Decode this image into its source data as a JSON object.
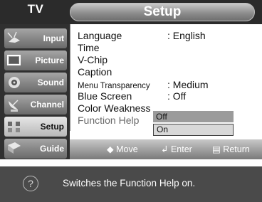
{
  "header": {
    "source_label": "TV",
    "menu_title": "Setup"
  },
  "sidebar": {
    "items": [
      {
        "label": "Input",
        "icon": "antenna-icon",
        "active": false
      },
      {
        "label": "Picture",
        "icon": "picture-screen-icon",
        "active": false
      },
      {
        "label": "Sound",
        "icon": "speaker-icon",
        "active": false
      },
      {
        "label": "Channel",
        "icon": "satellite-dish-icon",
        "active": false
      },
      {
        "label": "Setup",
        "icon": "setup-blocks-icon",
        "active": true
      },
      {
        "label": "Guide",
        "icon": "guide-book-icon",
        "active": false
      }
    ]
  },
  "menu": {
    "items": [
      {
        "name": "Language",
        "value": ": English"
      },
      {
        "name": "Time",
        "value": ""
      },
      {
        "name": "V-Chip",
        "value": ""
      },
      {
        "name": "Caption",
        "value": ""
      },
      {
        "name": "Menu Transparency",
        "value": ": Medium"
      },
      {
        "name": "Blue Screen",
        "value": ": Off"
      },
      {
        "name": "Color Weakness",
        "value": ""
      },
      {
        "name": "Function Help",
        "value": ""
      }
    ],
    "dropdown": {
      "options": [
        "Off",
        "On"
      ],
      "selected": "On"
    }
  },
  "navbar": {
    "move": "Move",
    "enter": "Enter",
    "return": "Return"
  },
  "help": {
    "text": "Switches the Function Help on.",
    "icon": "question-icon"
  },
  "colors": {
    "panel_dark": "#2b2b2b",
    "help_bar": "#4a4a4a",
    "active_item": "#d6d6d6"
  }
}
